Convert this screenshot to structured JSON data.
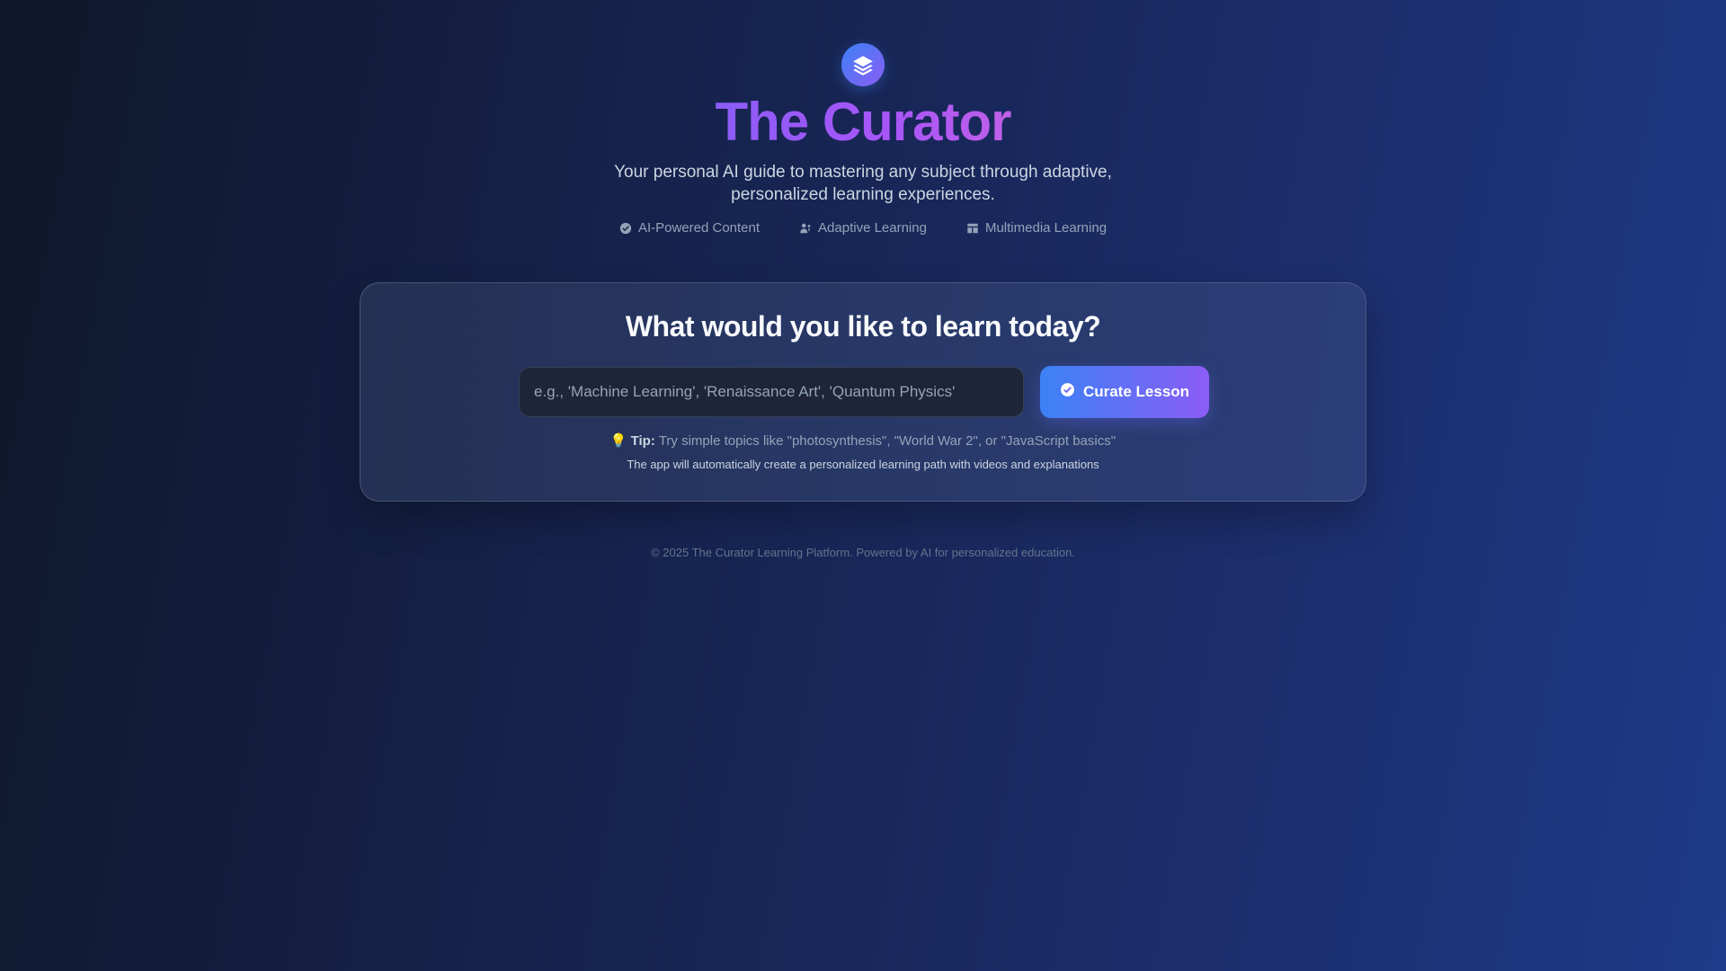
{
  "app": {
    "title": "The Curator",
    "subtitle": "Your personal AI guide to mastering any subject through adaptive, personalized learning experiences.",
    "logo_icon": "layers-icon"
  },
  "features": [
    {
      "label": "AI-Powered Content",
      "icon": "check-badge-icon"
    },
    {
      "label": "Adaptive Learning",
      "icon": "user-adjust-icon"
    },
    {
      "label": "Multimedia Learning",
      "icon": "layout-icon"
    }
  ],
  "card": {
    "heading": "What would you like to learn today?",
    "input_placeholder": "e.g., 'Machine Learning', 'Renaissance Art', 'Quantum Physics'",
    "input_value": "",
    "button_label": "Curate Lesson",
    "tip_icon": "💡",
    "tip_label": "Tip:",
    "tip_text": "Try simple topics like \"photosynthesis\", \"World War 2\", or \"JavaScript basics\"",
    "tip_note": "The app will automatically create a personalized learning path with videos and explanations"
  },
  "footer": {
    "text": "© 2025 The Curator Learning Platform. Powered by AI for personalized education."
  },
  "colors": {
    "accent_blue": "#3b82f6",
    "accent_purple": "#8b5cf6",
    "background_dark": "#0f172a",
    "background_blue": "#1e3a8a"
  }
}
